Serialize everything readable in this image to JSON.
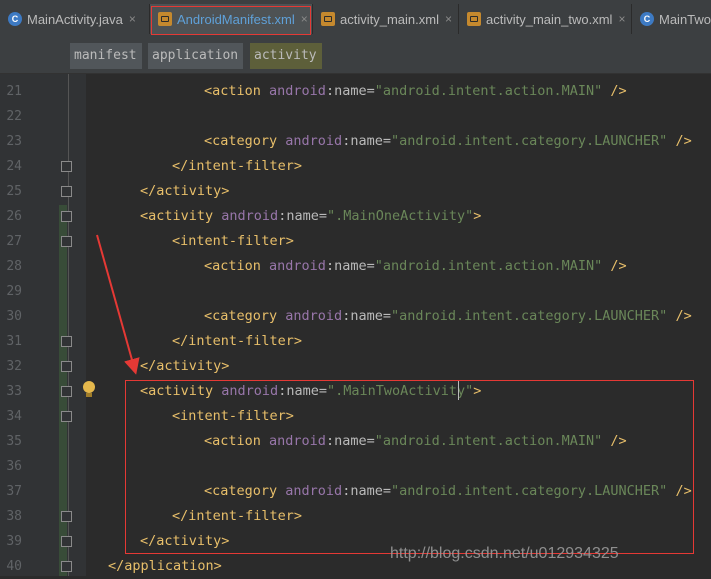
{
  "tabs": [
    {
      "label": "MainActivity.java",
      "icon": "class-icon",
      "active": false
    },
    {
      "label": "AndroidManifest.xml",
      "icon": "xml-file-icon",
      "active": true
    },
    {
      "label": "activity_main.xml",
      "icon": "xml-file-icon",
      "active": false
    },
    {
      "label": "activity_main_two.xml",
      "icon": "xml-file-icon",
      "active": false
    },
    {
      "label": "MainTwo",
      "icon": "class-icon",
      "active": false
    }
  ],
  "close_glyph": "×",
  "breadcrumbs": [
    "manifest",
    "application",
    "activity"
  ],
  "lines": [
    {
      "n": "21",
      "parts": [
        [
          "t",
          "<action "
        ],
        [
          "an",
          "android"
        ],
        [
          "ap",
          ":name="
        ],
        [
          "av",
          "\"android.intent.action.MAIN\""
        ],
        [
          "t",
          " />"
        ]
      ]
    },
    {
      "n": "22",
      "parts": []
    },
    {
      "n": "23",
      "parts": [
        [
          "t",
          "<category "
        ],
        [
          "an",
          "android"
        ],
        [
          "ap",
          ":name="
        ],
        [
          "av",
          "\"android.intent.category.LAUNCHER\""
        ],
        [
          "t",
          " />"
        ]
      ]
    },
    {
      "n": "24",
      "parts": [
        [
          "t",
          "</intent-filter>"
        ]
      ]
    },
    {
      "n": "25",
      "parts": [
        [
          "t",
          "</activity>"
        ]
      ]
    },
    {
      "n": "26",
      "parts": [
        [
          "t",
          "<activity "
        ],
        [
          "an",
          "android"
        ],
        [
          "ap",
          ":name="
        ],
        [
          "av",
          "\".MainOneActivity\""
        ],
        [
          "t",
          ">"
        ]
      ]
    },
    {
      "n": "27",
      "parts": [
        [
          "t",
          "<intent-filter>"
        ]
      ]
    },
    {
      "n": "28",
      "parts": [
        [
          "t",
          "<action "
        ],
        [
          "an",
          "android"
        ],
        [
          "ap",
          ":name="
        ],
        [
          "av",
          "\"android.intent.action.MAIN\""
        ],
        [
          "t",
          " />"
        ]
      ]
    },
    {
      "n": "29",
      "parts": []
    },
    {
      "n": "30",
      "parts": [
        [
          "t",
          "<category "
        ],
        [
          "an",
          "android"
        ],
        [
          "ap",
          ":name="
        ],
        [
          "av",
          "\"android.intent.category.LAUNCHER\""
        ],
        [
          "t",
          " />"
        ]
      ]
    },
    {
      "n": "31",
      "parts": [
        [
          "t",
          "</intent-filter>"
        ]
      ]
    },
    {
      "n": "32",
      "parts": [
        [
          "t",
          "</activity>"
        ]
      ]
    },
    {
      "n": "33",
      "parts": [
        [
          "t",
          "<activity "
        ],
        [
          "an",
          "android"
        ],
        [
          "ap",
          ":name="
        ],
        [
          "av",
          "\".MainTwoActivity\""
        ],
        [
          "t",
          ">"
        ]
      ]
    },
    {
      "n": "34",
      "parts": [
        [
          "t",
          "<intent-filter>"
        ]
      ]
    },
    {
      "n": "35",
      "parts": [
        [
          "t",
          "<action "
        ],
        [
          "an",
          "android"
        ],
        [
          "ap",
          ":name="
        ],
        [
          "av",
          "\"android.intent.action.MAIN\""
        ],
        [
          "t",
          " />"
        ]
      ]
    },
    {
      "n": "36",
      "parts": []
    },
    {
      "n": "37",
      "parts": [
        [
          "t",
          "<category "
        ],
        [
          "an",
          "android"
        ],
        [
          "ap",
          ":name="
        ],
        [
          "av",
          "\"android.intent.category.LAUNCHER\""
        ],
        [
          "t",
          " />"
        ]
      ]
    },
    {
      "n": "38",
      "parts": [
        [
          "t",
          "</intent-filter>"
        ]
      ]
    },
    {
      "n": "39",
      "parts": [
        [
          "t",
          "</activity>"
        ]
      ]
    },
    {
      "n": "40",
      "parts": [
        [
          "t",
          "</application>"
        ]
      ]
    }
  ],
  "watermark": "http://blog.csdn.net/u012934325",
  "colors": {
    "tag": "#e8bf6a",
    "namespace": "#9876aa",
    "attr": "#bababa",
    "value": "#6a8759",
    "annotation": "#e53935"
  }
}
